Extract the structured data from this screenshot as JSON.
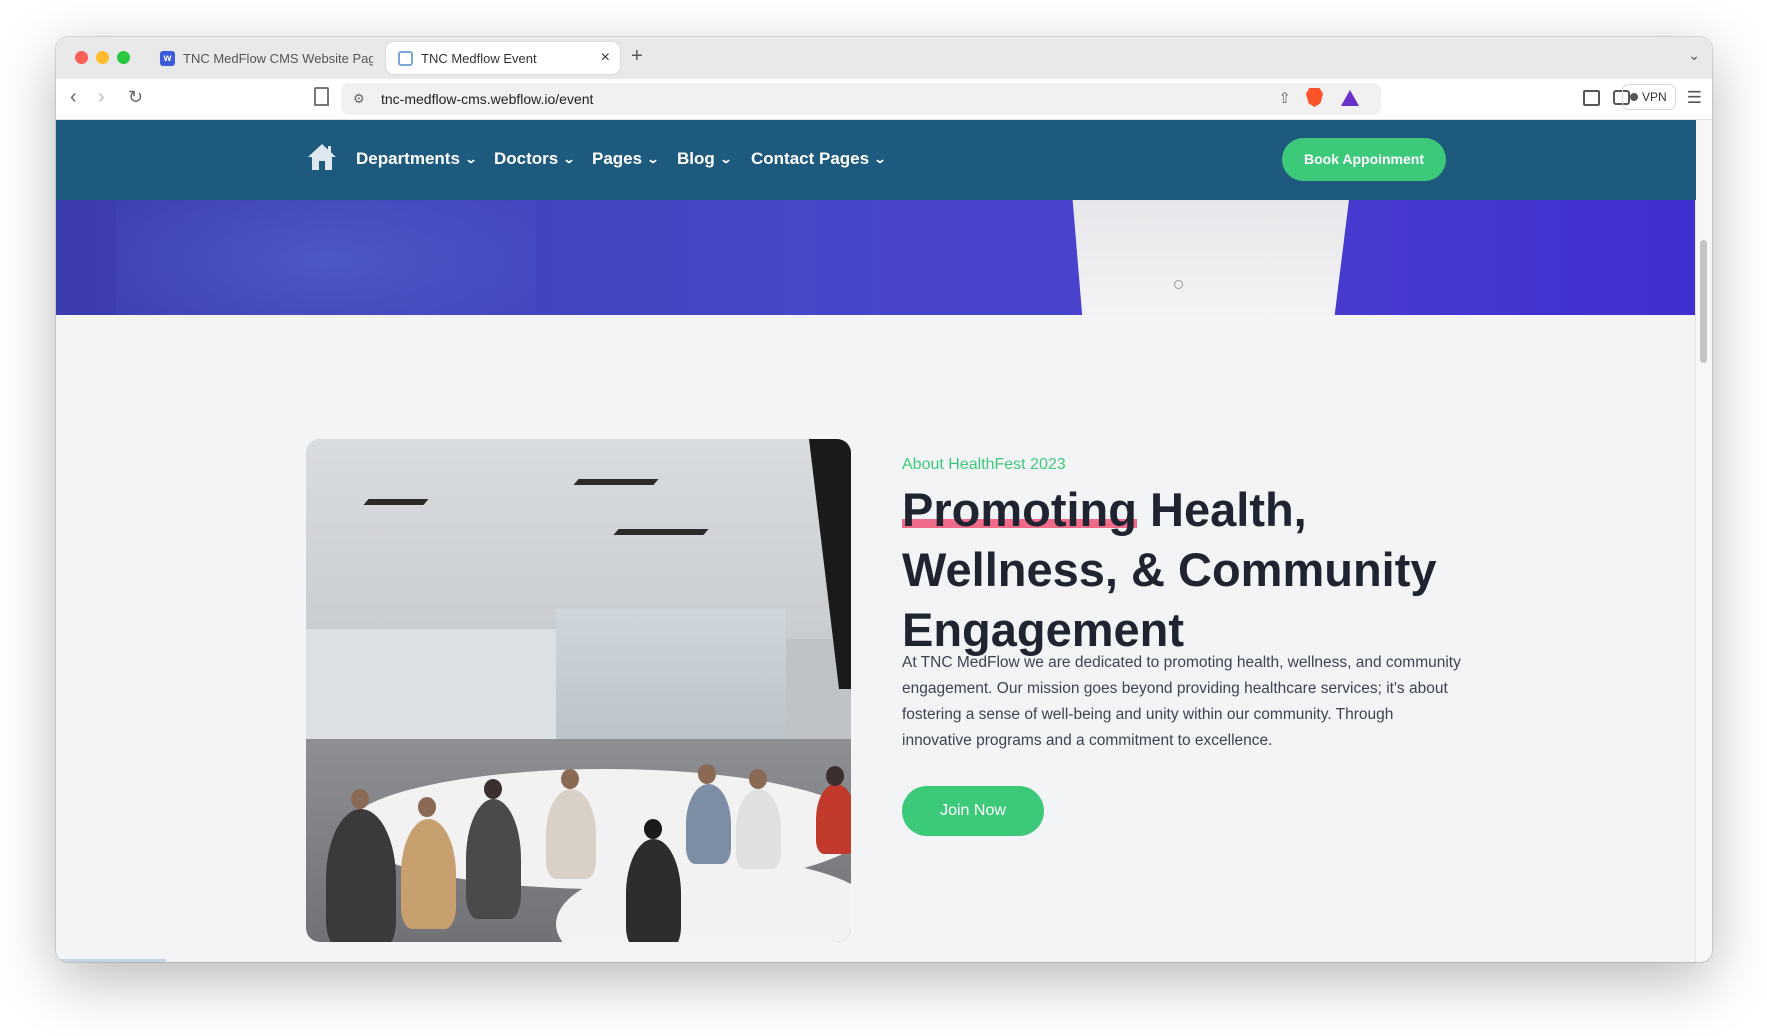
{
  "browser": {
    "tabs": [
      {
        "title": "TNC MedFlow CMS Website Page",
        "active": false,
        "favicon": "webflow-icon"
      },
      {
        "title": "TNC Medflow Event",
        "active": true,
        "favicon": "medflow-icon"
      }
    ],
    "new_tab": "+",
    "close": "×",
    "url": "tnc-medflow-cms.webflow.io/event",
    "vpn_label": "VPN"
  },
  "site": {
    "nav": {
      "items": [
        {
          "label": "Departments"
        },
        {
          "label": "Doctors"
        },
        {
          "label": "Pages"
        },
        {
          "label": "Blog"
        },
        {
          "label": "Contact Pages"
        }
      ],
      "cta": "Book Appoinment"
    },
    "about": {
      "label": "About HealthFest 2023",
      "heading_highlight": "Promoting",
      "heading_line1_rest": " Health,",
      "heading_line2": "Wellness, & Community",
      "heading_line3": "Engagement",
      "description": "At TNC MedFlow we are dedicated to promoting health, wellness, and community engagement. Our mission goes beyond providing healthcare services; it's about fostering a sense of well-being and unity within our community. Through innovative programs and a commitment to excellence.",
      "button": "Join Now"
    }
  },
  "colors": {
    "nav_bg": "#1e5a7e",
    "accent_green": "#3dc97a",
    "highlight_pink": "#f06b8a",
    "hero_purple": "#4747c7",
    "heading_text": "#1f2430"
  }
}
